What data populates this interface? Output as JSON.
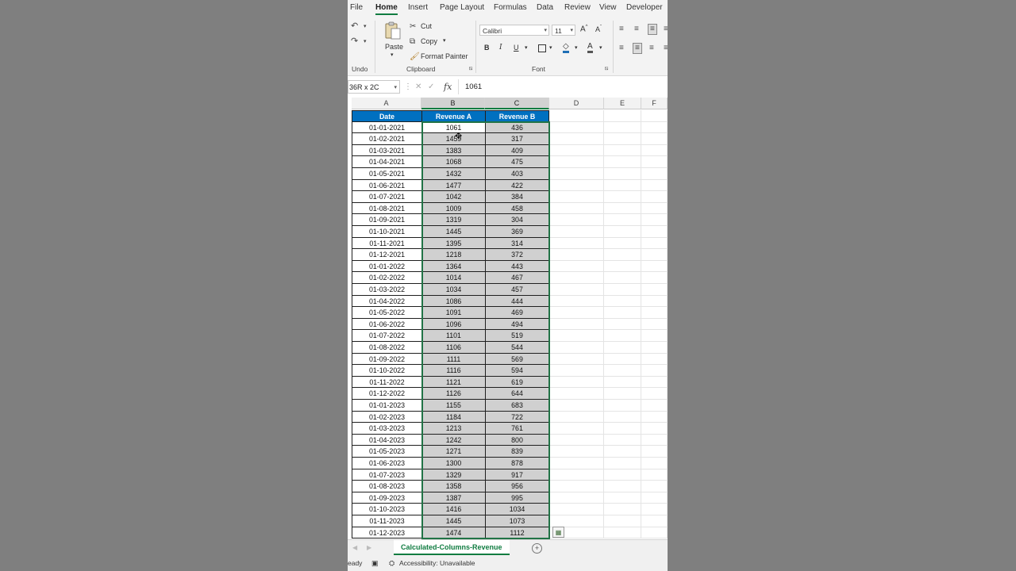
{
  "ribbon": {
    "tabs": [
      "File",
      "Home",
      "Insert",
      "Page Layout",
      "Formulas",
      "Data",
      "Review",
      "View",
      "Developer"
    ],
    "active_tab": "Home",
    "undo_group_label": "Undo",
    "clipboard": {
      "paste_label": "Paste",
      "cut_label": "Cut",
      "copy_label": "Copy",
      "format_painter_label": "Format Painter",
      "group_label": "Clipboard"
    },
    "font": {
      "font_name": "Calibri",
      "font_size": "11",
      "bold_label": "B",
      "italic_label": "I",
      "underline_label": "U",
      "font_color_label": "A",
      "grow_label": "A",
      "shrink_label": "A",
      "group_label": "Font"
    }
  },
  "formula_bar": {
    "name_box": "36R x 2C",
    "fx_label": "fx",
    "value": "1061"
  },
  "grid": {
    "column_headers": [
      "A",
      "B",
      "C",
      "D",
      "E",
      "F"
    ],
    "table_headers": [
      "Date",
      "Revenue A",
      "Revenue B"
    ],
    "rows": [
      [
        "01-01-2021",
        "1061",
        "436"
      ],
      [
        "01-02-2021",
        "1459",
        "317"
      ],
      [
        "01-03-2021",
        "1383",
        "409"
      ],
      [
        "01-04-2021",
        "1068",
        "475"
      ],
      [
        "01-05-2021",
        "1432",
        "403"
      ],
      [
        "01-06-2021",
        "1477",
        "422"
      ],
      [
        "01-07-2021",
        "1042",
        "384"
      ],
      [
        "01-08-2021",
        "1009",
        "458"
      ],
      [
        "01-09-2021",
        "1319",
        "304"
      ],
      [
        "01-10-2021",
        "1445",
        "369"
      ],
      [
        "01-11-2021",
        "1395",
        "314"
      ],
      [
        "01-12-2021",
        "1218",
        "372"
      ],
      [
        "01-01-2022",
        "1364",
        "443"
      ],
      [
        "01-02-2022",
        "1014",
        "467"
      ],
      [
        "01-03-2022",
        "1034",
        "457"
      ],
      [
        "01-04-2022",
        "1086",
        "444"
      ],
      [
        "01-05-2022",
        "1091",
        "469"
      ],
      [
        "01-06-2022",
        "1096",
        "494"
      ],
      [
        "01-07-2022",
        "1101",
        "519"
      ],
      [
        "01-08-2022",
        "1106",
        "544"
      ],
      [
        "01-09-2022",
        "1111",
        "569"
      ],
      [
        "01-10-2022",
        "1116",
        "594"
      ],
      [
        "01-11-2022",
        "1121",
        "619"
      ],
      [
        "01-12-2022",
        "1126",
        "644"
      ],
      [
        "01-01-2023",
        "1155",
        "683"
      ],
      [
        "01-02-2023",
        "1184",
        "722"
      ],
      [
        "01-03-2023",
        "1213",
        "761"
      ],
      [
        "01-04-2023",
        "1242",
        "800"
      ],
      [
        "01-05-2023",
        "1271",
        "839"
      ],
      [
        "01-06-2023",
        "1300",
        "878"
      ],
      [
        "01-07-2023",
        "1329",
        "917"
      ],
      [
        "01-08-2023",
        "1358",
        "956"
      ],
      [
        "01-09-2023",
        "1387",
        "995"
      ],
      [
        "01-10-2023",
        "1416",
        "1034"
      ],
      [
        "01-11-2023",
        "1445",
        "1073"
      ],
      [
        "01-12-2023",
        "1474",
        "1112"
      ]
    ],
    "header_fill_color": "#0070c0",
    "selection_fill_color": "#d0d0d0",
    "selection_border_color": "#217346"
  },
  "sheets": {
    "active": "Calculated-Columns-Revenue",
    "add_icon": "plus-circle-icon"
  },
  "status_bar": {
    "ready_text": "eady",
    "accessibility_text": "Accessibility: Unavailable"
  }
}
